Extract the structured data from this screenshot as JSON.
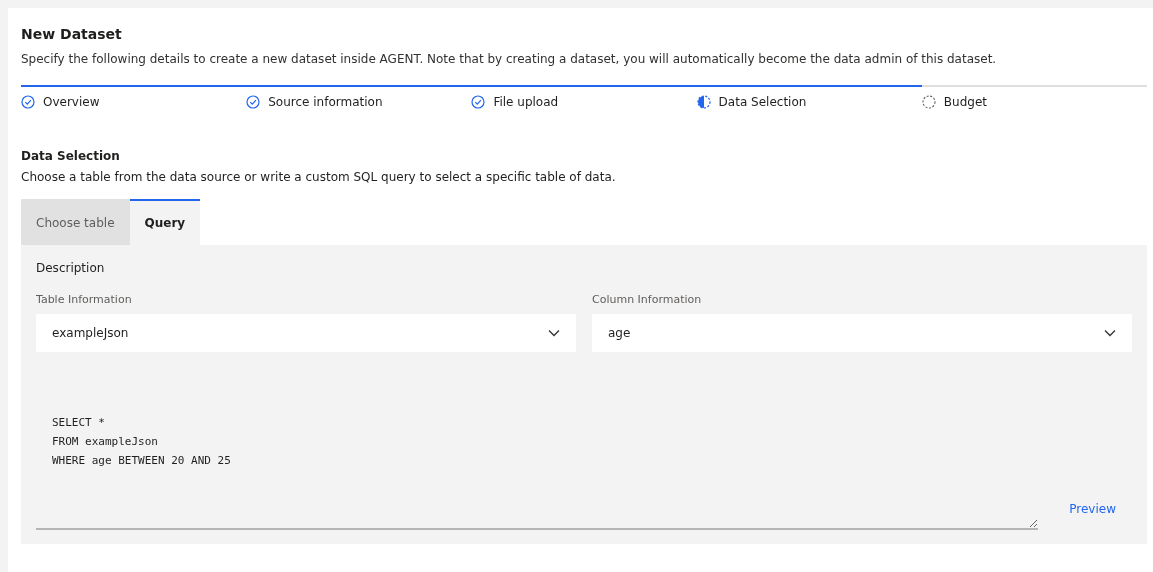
{
  "title": "New Dataset",
  "description": "Specify the following details to create a new dataset inside AGENT. Note that by creating a dataset, you will automatically become the data admin of this dataset.",
  "steps": [
    {
      "label": "Overview",
      "kind": "done"
    },
    {
      "label": "Source information",
      "kind": "done"
    },
    {
      "label": "File upload",
      "kind": "done"
    },
    {
      "label": "Data Selection",
      "kind": "current"
    },
    {
      "label": "Budget",
      "kind": "pending"
    }
  ],
  "section": {
    "title": "Data Selection",
    "description": "Choose a table from the data source or write a custom SQL query to select a specific table of data."
  },
  "tabs": [
    {
      "label": "Choose table",
      "selected": false
    },
    {
      "label": "Query",
      "selected": true
    }
  ],
  "panel": {
    "title": "Description",
    "fields": [
      {
        "label": "Table Information",
        "value": "exampleJson"
      },
      {
        "label": "Column Information",
        "value": "age"
      }
    ],
    "query": "SELECT *\nFROM exampleJson\nWHERE age BETWEEN 20 AND 25",
    "link": "Preview"
  }
}
